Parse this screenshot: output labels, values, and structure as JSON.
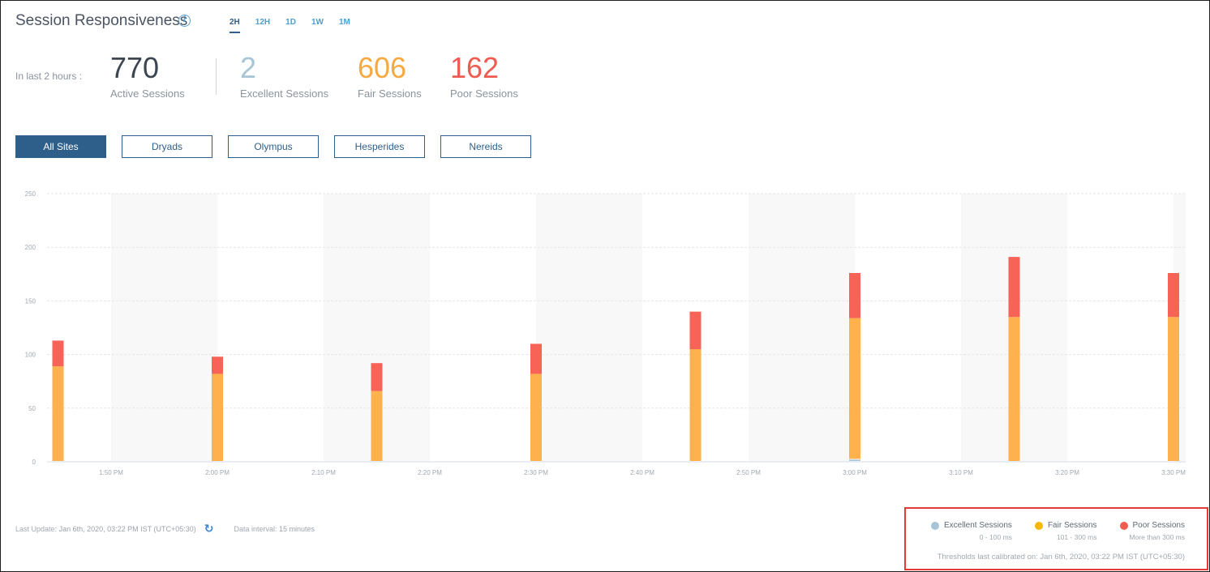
{
  "header": {
    "title": "Session Responsiveness",
    "info_icon": "info-icon",
    "time_tabs": [
      {
        "label": "2H",
        "active": true
      },
      {
        "label": "12H",
        "active": false
      },
      {
        "label": "1D",
        "active": false
      },
      {
        "label": "1W",
        "active": false
      },
      {
        "label": "1M",
        "active": false
      }
    ]
  },
  "summary": {
    "lead": "In last 2 hours :",
    "kpis": [
      {
        "value": "770",
        "label": "Active Sessions",
        "color": "#3d4650"
      },
      {
        "value": "2",
        "label": "Excellent Sessions",
        "color": "#a8c5d6"
      },
      {
        "value": "606",
        "label": "Fair Sessions",
        "color": "#f7a941"
      },
      {
        "value": "162",
        "label": "Poor Sessions",
        "color": "#ef5b50"
      }
    ]
  },
  "sites": [
    {
      "label": "All Sites",
      "active": true
    },
    {
      "label": "Dryads",
      "active": false
    },
    {
      "label": "Olympus",
      "active": false
    },
    {
      "label": "Hesperides",
      "active": false
    },
    {
      "label": "Nereids",
      "active": false
    }
  ],
  "chart_data": {
    "type": "bar",
    "stacked": true,
    "title": "",
    "xlabel": "",
    "ylabel": "",
    "ylim": [
      0,
      250
    ],
    "yticks": [
      0,
      50,
      100,
      150,
      200,
      250
    ],
    "xticks": [
      "1:50 PM",
      "2:00 PM",
      "2:10 PM",
      "2:20 PM",
      "2:30 PM",
      "2:40 PM",
      "2:50 PM",
      "3:00 PM",
      "3:10 PM",
      "3:20 PM",
      "3:30 PM"
    ],
    "categories": [
      "1:45 PM",
      "2:00 PM",
      "2:15 PM",
      "2:30 PM",
      "2:45 PM",
      "3:00 PM",
      "3:15 PM",
      "3:30 PM"
    ],
    "grid": true,
    "series": [
      {
        "name": "Excellent Sessions",
        "color": "#a8c5d6",
        "values": [
          0,
          0,
          0,
          0,
          0,
          2,
          0,
          0
        ]
      },
      {
        "name": "Fair Sessions",
        "color": "#ffb14e",
        "values": [
          89,
          82,
          66,
          82,
          105,
          132,
          135,
          135
        ]
      },
      {
        "name": "Poor Sessions",
        "color": "#f76356",
        "values": [
          24,
          16,
          26,
          28,
          35,
          42,
          56,
          41
        ]
      }
    ],
    "legend": "bottom-right"
  },
  "footer": {
    "last_update_label": "Last Update:",
    "last_update_value": "Jan 6th, 2020, 03:22 PM IST (UTC+05:30)",
    "refresh_icon": "refresh-icon",
    "interval_label": "Data interval:",
    "interval_value": "15 minutes"
  },
  "legend": {
    "items": [
      {
        "name": "Excellent Sessions",
        "range": "0 - 100 ms",
        "color": "#a8c5d6"
      },
      {
        "name": "Fair Sessions",
        "range": "101 - 300 ms",
        "color": "#f5b800"
      },
      {
        "name": "Poor Sessions",
        "range": "More than 300 ms",
        "color": "#ef5b50"
      }
    ],
    "calibration_label": "Thresholds last calibrated on:",
    "calibration_value": "Jan 6th, 2020, 03:22 PM IST (UTC+05:30)"
  }
}
